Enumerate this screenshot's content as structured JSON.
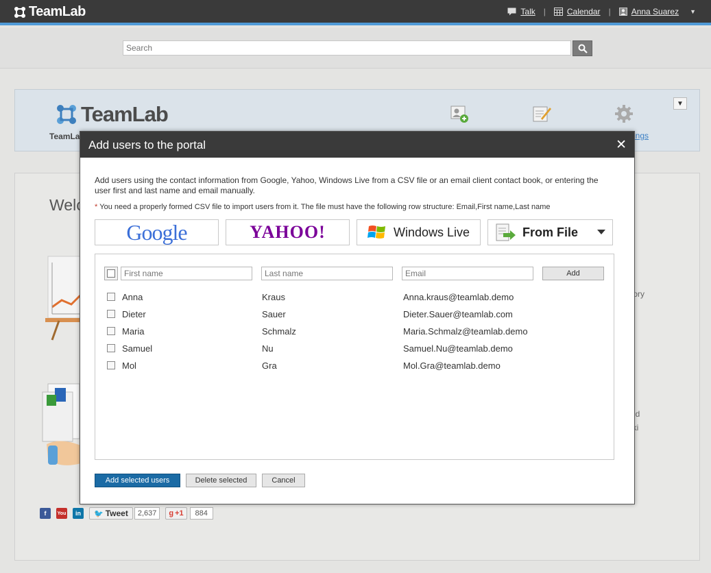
{
  "app": {
    "brand": "TeamLab"
  },
  "topnav": {
    "talk": "Talk",
    "calendar": "Calendar",
    "user": "Anna Suarez"
  },
  "search": {
    "placeholder": "Search"
  },
  "portal": {
    "logo": "TeamLab",
    "subtitle": "TeamLa",
    "settings_link": "ings"
  },
  "background": {
    "welcome": "Welc",
    "text_tory": "tory",
    "text_nd": "nd",
    "text_iki": "iki"
  },
  "social": {
    "tweet_label": "Tweet",
    "tweet_count": "2,637",
    "gplus_label": "+1",
    "gplus_count": "884"
  },
  "dialog": {
    "title": "Add users to the portal",
    "description": "Add users using the contact information from Google, Yahoo, Windows Live from a CSV file or an email client contact book, or entering the user first and last name and email manually.",
    "note_star": "*",
    "note": "You need a properly formed CSV file to import users from it. The file must have the following row structure: Email,First name,Last name",
    "providers": {
      "google": "Google",
      "yahoo": "YAHOO!",
      "windows_live": "Windows Live",
      "from_file": "From File"
    },
    "form": {
      "first_name_placeholder": "First name",
      "last_name_placeholder": "Last name",
      "email_placeholder": "Email",
      "add_label": "Add"
    },
    "users": [
      {
        "first": "Anna",
        "last": "Kraus",
        "email": "Anna.kraus@teamlab.demo"
      },
      {
        "first": "Dieter",
        "last": "Sauer",
        "email": "Dieter.Sauer@teamlab.com"
      },
      {
        "first": "Maria",
        "last": "Schmalz",
        "email": "Maria.Schmalz@teamlab.demo"
      },
      {
        "first": "Samuel",
        "last": "Nu",
        "email": "Samuel.Nu@teamlab.demo"
      },
      {
        "first": "Mol",
        "last": "Gra",
        "email": "Mol.Gra@teamlab.demo"
      }
    ],
    "buttons": {
      "add_selected": "Add selected users",
      "delete_selected": "Delete selected",
      "cancel": "Cancel"
    }
  },
  "colors": {
    "topbar": "#3a3a3a",
    "accent_line": "#4f9ad7",
    "primary_button": "#1b6ba5",
    "link": "#3b7fc4"
  }
}
